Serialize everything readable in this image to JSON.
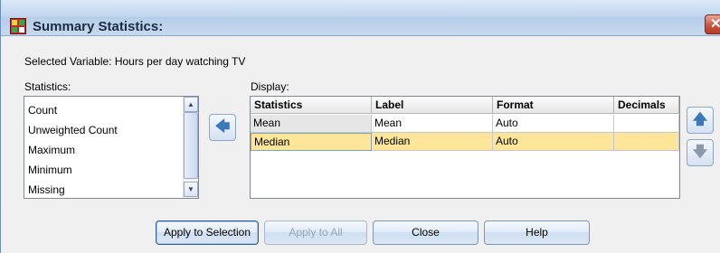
{
  "dialog": {
    "title": "Summary Statistics:",
    "close_symbol": "✕"
  },
  "selected_variable": "Selected Variable: Hours per day watching TV",
  "statistics_panel": {
    "label": "Statistics:",
    "items": [
      "Count",
      "Unweighted Count",
      "Maximum",
      "Minimum",
      "Missing"
    ]
  },
  "display_panel": {
    "label": "Display:",
    "columns": [
      "Statistics",
      "Label",
      "Format",
      "Decimals"
    ],
    "rows": [
      {
        "statistics": "Mean",
        "label": "Mean",
        "format": "Auto",
        "decimals": ""
      },
      {
        "statistics": "Median",
        "label": "Median",
        "format": "Auto",
        "decimals": ""
      }
    ],
    "selected_row": 1
  },
  "arrows": {
    "move_left": "🡄",
    "move_up": "🡅",
    "move_down": "🡇"
  },
  "buttons": {
    "apply_selection": "Apply to Selection",
    "apply_all": "Apply to All",
    "close": "Close",
    "help": "Help"
  },
  "colors": {
    "selected_row": "#fde59a",
    "title_gradient": "#c3d7ee",
    "close_button": "#c8553f"
  }
}
